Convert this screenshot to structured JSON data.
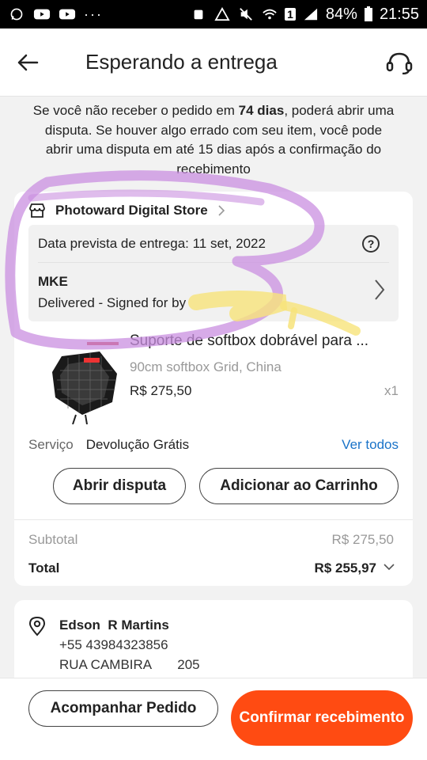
{
  "status_bar": {
    "battery": "84%",
    "time": "21:55",
    "sim_badge": "1"
  },
  "header": {
    "title": "Esperando a entrega"
  },
  "notice": {
    "part1": "Se você não receber o pedido em ",
    "days": "74 dias",
    "part2": ", poderá abrir uma disputa. Se houver algo errado com seu item, você pode abrir uma disputa em até 15 dias após a confirmação do recebimento"
  },
  "order": {
    "store_name": "Photoward Digital Store",
    "delivery_estimate": "Data prevista de entrega: 11 set, 2022",
    "carrier": "MKE",
    "tracking_status": "Delivered - Signed for by",
    "product": {
      "title": "Suporte de softbox dobrável para ...",
      "variant": "90cm softbox Grid, China",
      "price": "R$ 275,50",
      "quantity": "x1"
    },
    "service": {
      "label": "Serviço",
      "value": "Devolução Grátis",
      "link": "Ver todos"
    },
    "buttons": {
      "dispute": "Abrir disputa",
      "add_to_cart": "Adicionar ao Carrinho"
    },
    "subtotal_label": "Subtotal",
    "subtotal_value": "R$ 275,50",
    "total_label": "Total",
    "total_value": "R$ 255,97"
  },
  "address": {
    "name": "Edson  R Martins",
    "phone": "+55 43984323856",
    "street": "RUA CAMBIRA       205"
  },
  "bottom_bar": {
    "track_label": "Acompanhar Pedido",
    "confirm_label": "Confirmar recebimento"
  },
  "colors": {
    "accent": "#ff4b12",
    "link": "#1a73c8",
    "annotation_purple": "#c98fe0",
    "annotation_yellow": "#f7e37a"
  },
  "icons": [
    "back-arrow-icon",
    "headset-icon",
    "store-icon",
    "chevron-right-icon",
    "help-icon",
    "location-pin-icon",
    "chevron-down-icon"
  ]
}
